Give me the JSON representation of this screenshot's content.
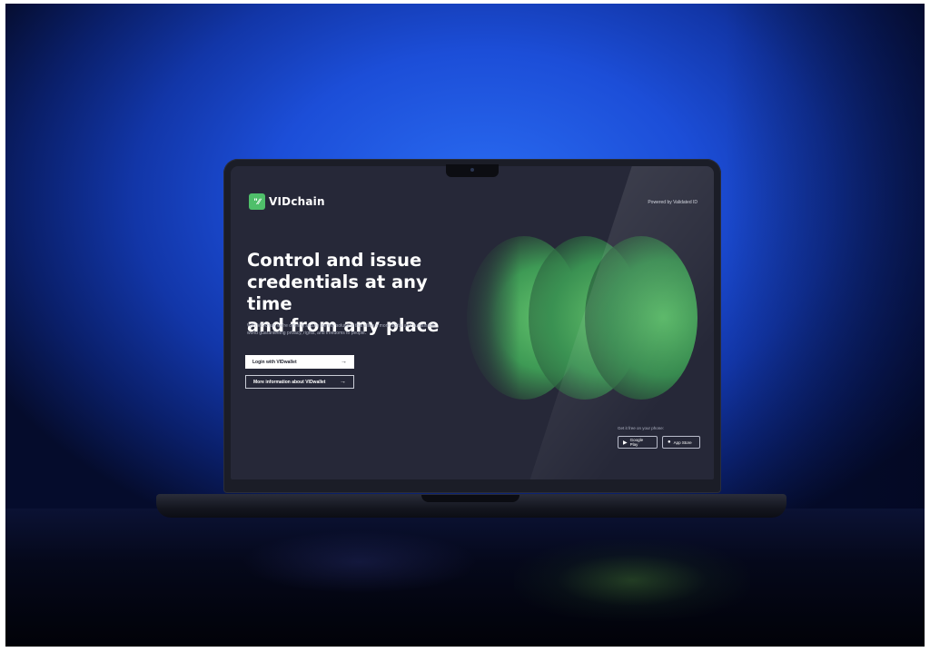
{
  "site": {
    "logo_mark": "\"∕∕",
    "logo_text": "VIDchain",
    "powered_by": "Powered by Validated ID"
  },
  "hero": {
    "headline_lines": [
      "Control and issue",
      "credentials at any time",
      "and from any place"
    ],
    "headline": "Control and issue credentials at any time and from any place",
    "subtext": "With VIDchain we're offering secure identity solutions that allow a more digital and sustainable world guaranteeing privacy, rights, and freedoms to people."
  },
  "buttons": {
    "login_label": "Login with VIDwallet",
    "login_arrow": "→",
    "more_info_label": "More information about VIDwallet",
    "more_info_arrow": "→"
  },
  "stores": {
    "label": "Get it free on your phone:",
    "google_play_label": "Google Play",
    "google_play_icon": "play-icon",
    "app_store_label": "App Store",
    "app_store_icon": "apple-icon"
  },
  "colors": {
    "background_blue": "#1c4ed8",
    "screen_bg": "#262838",
    "accent_green": "#4fbf6a"
  }
}
